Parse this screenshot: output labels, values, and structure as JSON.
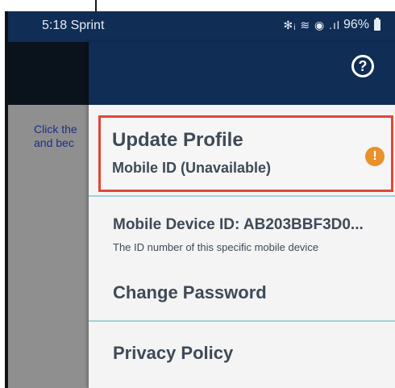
{
  "status_bar": {
    "time": "5:18",
    "carrier": "Sprint",
    "signal_icons": "✻ᵢ ≋ ◉ .ıl",
    "battery": "96%"
  },
  "background": {
    "text_line1": "Click the",
    "text_line2": "and bec"
  },
  "drawer": {
    "help_glyph": "?",
    "profile": {
      "title": "Update Profile",
      "subtitle": "Mobile ID (Unavailable)",
      "warning_glyph": "!"
    },
    "device_id_label": "Mobile Device ID: AB203BBF3D0...",
    "device_id_desc": "The ID number of this specific mobile device",
    "change_password": "Change Password",
    "privacy_policy": "Privacy Policy"
  },
  "colors": {
    "header": "#0f2d55",
    "highlight_border": "#e0463a",
    "warning": "#e9902b",
    "divider": "#9ed3d9"
  }
}
